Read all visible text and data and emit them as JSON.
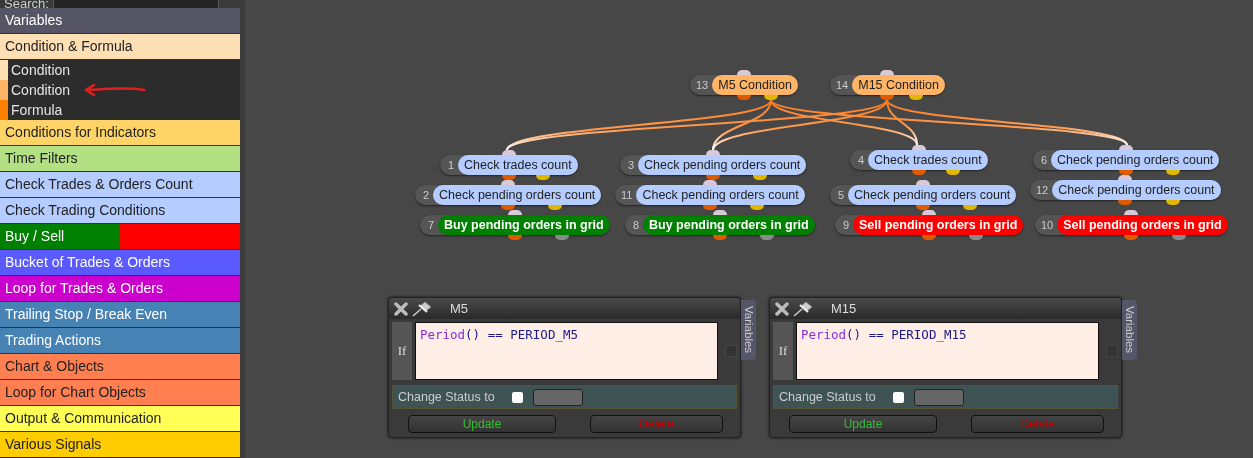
{
  "sidebar": {
    "search": {
      "label": "Search:"
    },
    "items": [
      {
        "label": "Variables",
        "color": "#555566"
      },
      {
        "label": "Condition & Formula",
        "color": "#ffe0b4",
        "expanded": true,
        "children": [
          {
            "label": "Condition",
            "color": "#ffe0b4"
          },
          {
            "label": "Condition",
            "color": "#ffb466"
          },
          {
            "label": "Formula",
            "color": "#ff8000"
          }
        ]
      },
      {
        "label": "Conditions for Indicators",
        "color": "#ffd466"
      },
      {
        "label": "Time Filters",
        "color": "#b4e084"
      },
      {
        "label": "Check Trades & Orders Count",
        "color": "#b4ccff"
      },
      {
        "label": "Check Trading Conditions",
        "color": "#b4ccff"
      },
      {
        "label": "Buy / Sell",
        "segments": [
          {
            "color": "#008000"
          },
          {
            "color": "#ff0000"
          }
        ]
      },
      {
        "label": "Bucket of Trades & Orders",
        "color": "#5a5aff"
      },
      {
        "label": "Loop for Trades & Orders",
        "color": "#cc00cc"
      },
      {
        "label": "Trailing Stop / Break Even",
        "color": "#4682b4"
      },
      {
        "label": "Trading Actions",
        "color": "#4682b4"
      },
      {
        "label": "Chart & Objects",
        "color": "#ff7f50"
      },
      {
        "label": "Loop for Chart Objects",
        "color": "#ff7f50"
      },
      {
        "label": "Output & Communication",
        "color": "#ffff55"
      },
      {
        "label": "Various Signals",
        "color": "#ffcc00"
      }
    ]
  },
  "nodes": [
    {
      "number": "13",
      "label": "M5 Condition",
      "kind": "condition"
    },
    {
      "number": "14",
      "label": "M15 Condition",
      "kind": "condition"
    },
    {
      "number": "1",
      "label": "Check trades count",
      "kind": "check"
    },
    {
      "number": "3",
      "label": "Check pending orders count",
      "kind": "check"
    },
    {
      "number": "4",
      "label": "Check trades count",
      "kind": "check"
    },
    {
      "number": "6",
      "label": "Check pending orders count",
      "kind": "check"
    },
    {
      "number": "2",
      "label": "Check pending orders count",
      "kind": "check"
    },
    {
      "number": "11",
      "label": "Check pending orders count",
      "kind": "check"
    },
    {
      "number": "5",
      "label": "Check pending orders count",
      "kind": "check"
    },
    {
      "number": "12",
      "label": "Check pending orders count",
      "kind": "check"
    },
    {
      "number": "7",
      "label": "Buy pending orders in grid",
      "kind": "buy"
    },
    {
      "number": "8",
      "label": "Buy pending orders in grid",
      "kind": "buy"
    },
    {
      "number": "9",
      "label": "Sell pending orders in grid",
      "kind": "sell"
    },
    {
      "number": "10",
      "label": "Sell pending orders in grid",
      "kind": "sell"
    }
  ],
  "panels": [
    {
      "title": "M5",
      "side_tab": "Variables",
      "condition_label": "If",
      "code": [
        {
          "text": "Period",
          "kind": "function"
        },
        {
          "text": "() == PERIOD_M5",
          "kind": "plain"
        }
      ],
      "side_checkbox": {
        "checked": false
      },
      "status_label": "Change Status to",
      "status_checkbox": {
        "checked": false
      },
      "buttons": [
        {
          "label": "Update",
          "kind": "update"
        },
        {
          "label": "Delete",
          "kind": "delete"
        }
      ]
    },
    {
      "title": "M15",
      "side_tab": "Variables",
      "condition_label": "If",
      "code": [
        {
          "text": "Period",
          "kind": "function"
        },
        {
          "text": "() == PERIOD_M15",
          "kind": "plain"
        }
      ],
      "side_checkbox": {
        "checked": false
      },
      "status_label": "Change Status to",
      "status_checkbox": {
        "checked": false
      },
      "buttons": [
        {
          "label": "Update",
          "kind": "update"
        },
        {
          "label": "Delete",
          "kind": "delete"
        }
      ]
    }
  ]
}
